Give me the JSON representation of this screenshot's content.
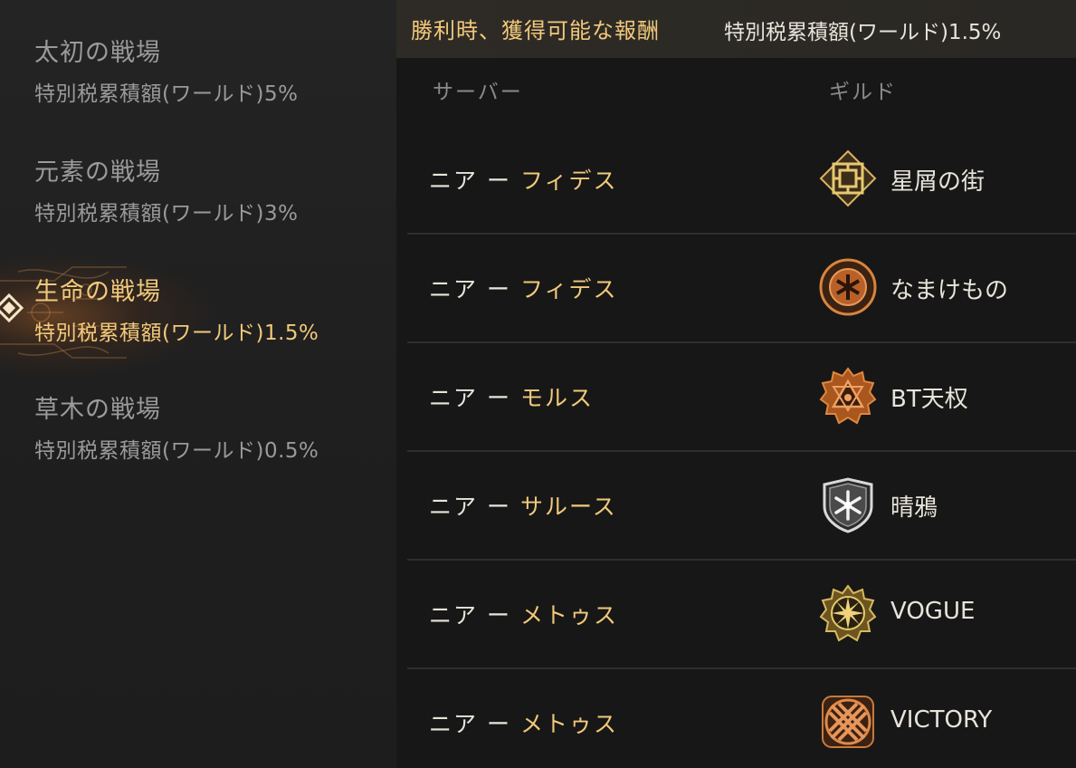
{
  "battlefields": [
    {
      "name": "太初の戦場",
      "tax": "特別税累積額(ワールド)5%",
      "active": false
    },
    {
      "name": "元素の戦場",
      "tax": "特別税累積額(ワールド)3%",
      "active": false
    },
    {
      "name": "生命の戦場",
      "tax": "特別税累積額(ワールド)1.5%",
      "active": true
    },
    {
      "name": "草木の戦場",
      "tax": "特別税累積額(ワールド)0.5%",
      "active": false
    }
  ],
  "reward": {
    "title": "勝利時、獲得可能な報酬",
    "value": "特別税累積額(ワールド)1.5%"
  },
  "table": {
    "headers": {
      "server": "サーバー",
      "guild": "ギルド"
    },
    "rows": [
      {
        "server_prefix": "ニア",
        "dash": "ー",
        "server_name": "フィデス",
        "guild": "星屑の街",
        "emblem": "square-knot-icon"
      },
      {
        "server_prefix": "ニア",
        "dash": "ー",
        "server_name": "フィデス",
        "guild": "なまけもの",
        "emblem": "circle-star-icon"
      },
      {
        "server_prefix": "ニア",
        "dash": "ー",
        "server_name": "モルス",
        "guild": "BT天权",
        "emblem": "gear-triangle-icon"
      },
      {
        "server_prefix": "ニア",
        "dash": "ー",
        "server_name": "サルース",
        "guild": "晴鴉",
        "emblem": "shield-snowflake-icon"
      },
      {
        "server_prefix": "ニア",
        "dash": "ー",
        "server_name": "メトゥス",
        "guild": "VOGUE",
        "emblem": "gear-sun-icon"
      },
      {
        "server_prefix": "ニア",
        "dash": "ー",
        "server_name": "メトゥス",
        "guild": "VICTORY",
        "emblem": "knot-cross-icon"
      }
    ]
  },
  "colors": {
    "accent": "#f2c97a",
    "text": "#e8e4da",
    "muted": "#9a9a9a",
    "bronze": "#c87a3c",
    "silver": "#c8c8c8"
  }
}
